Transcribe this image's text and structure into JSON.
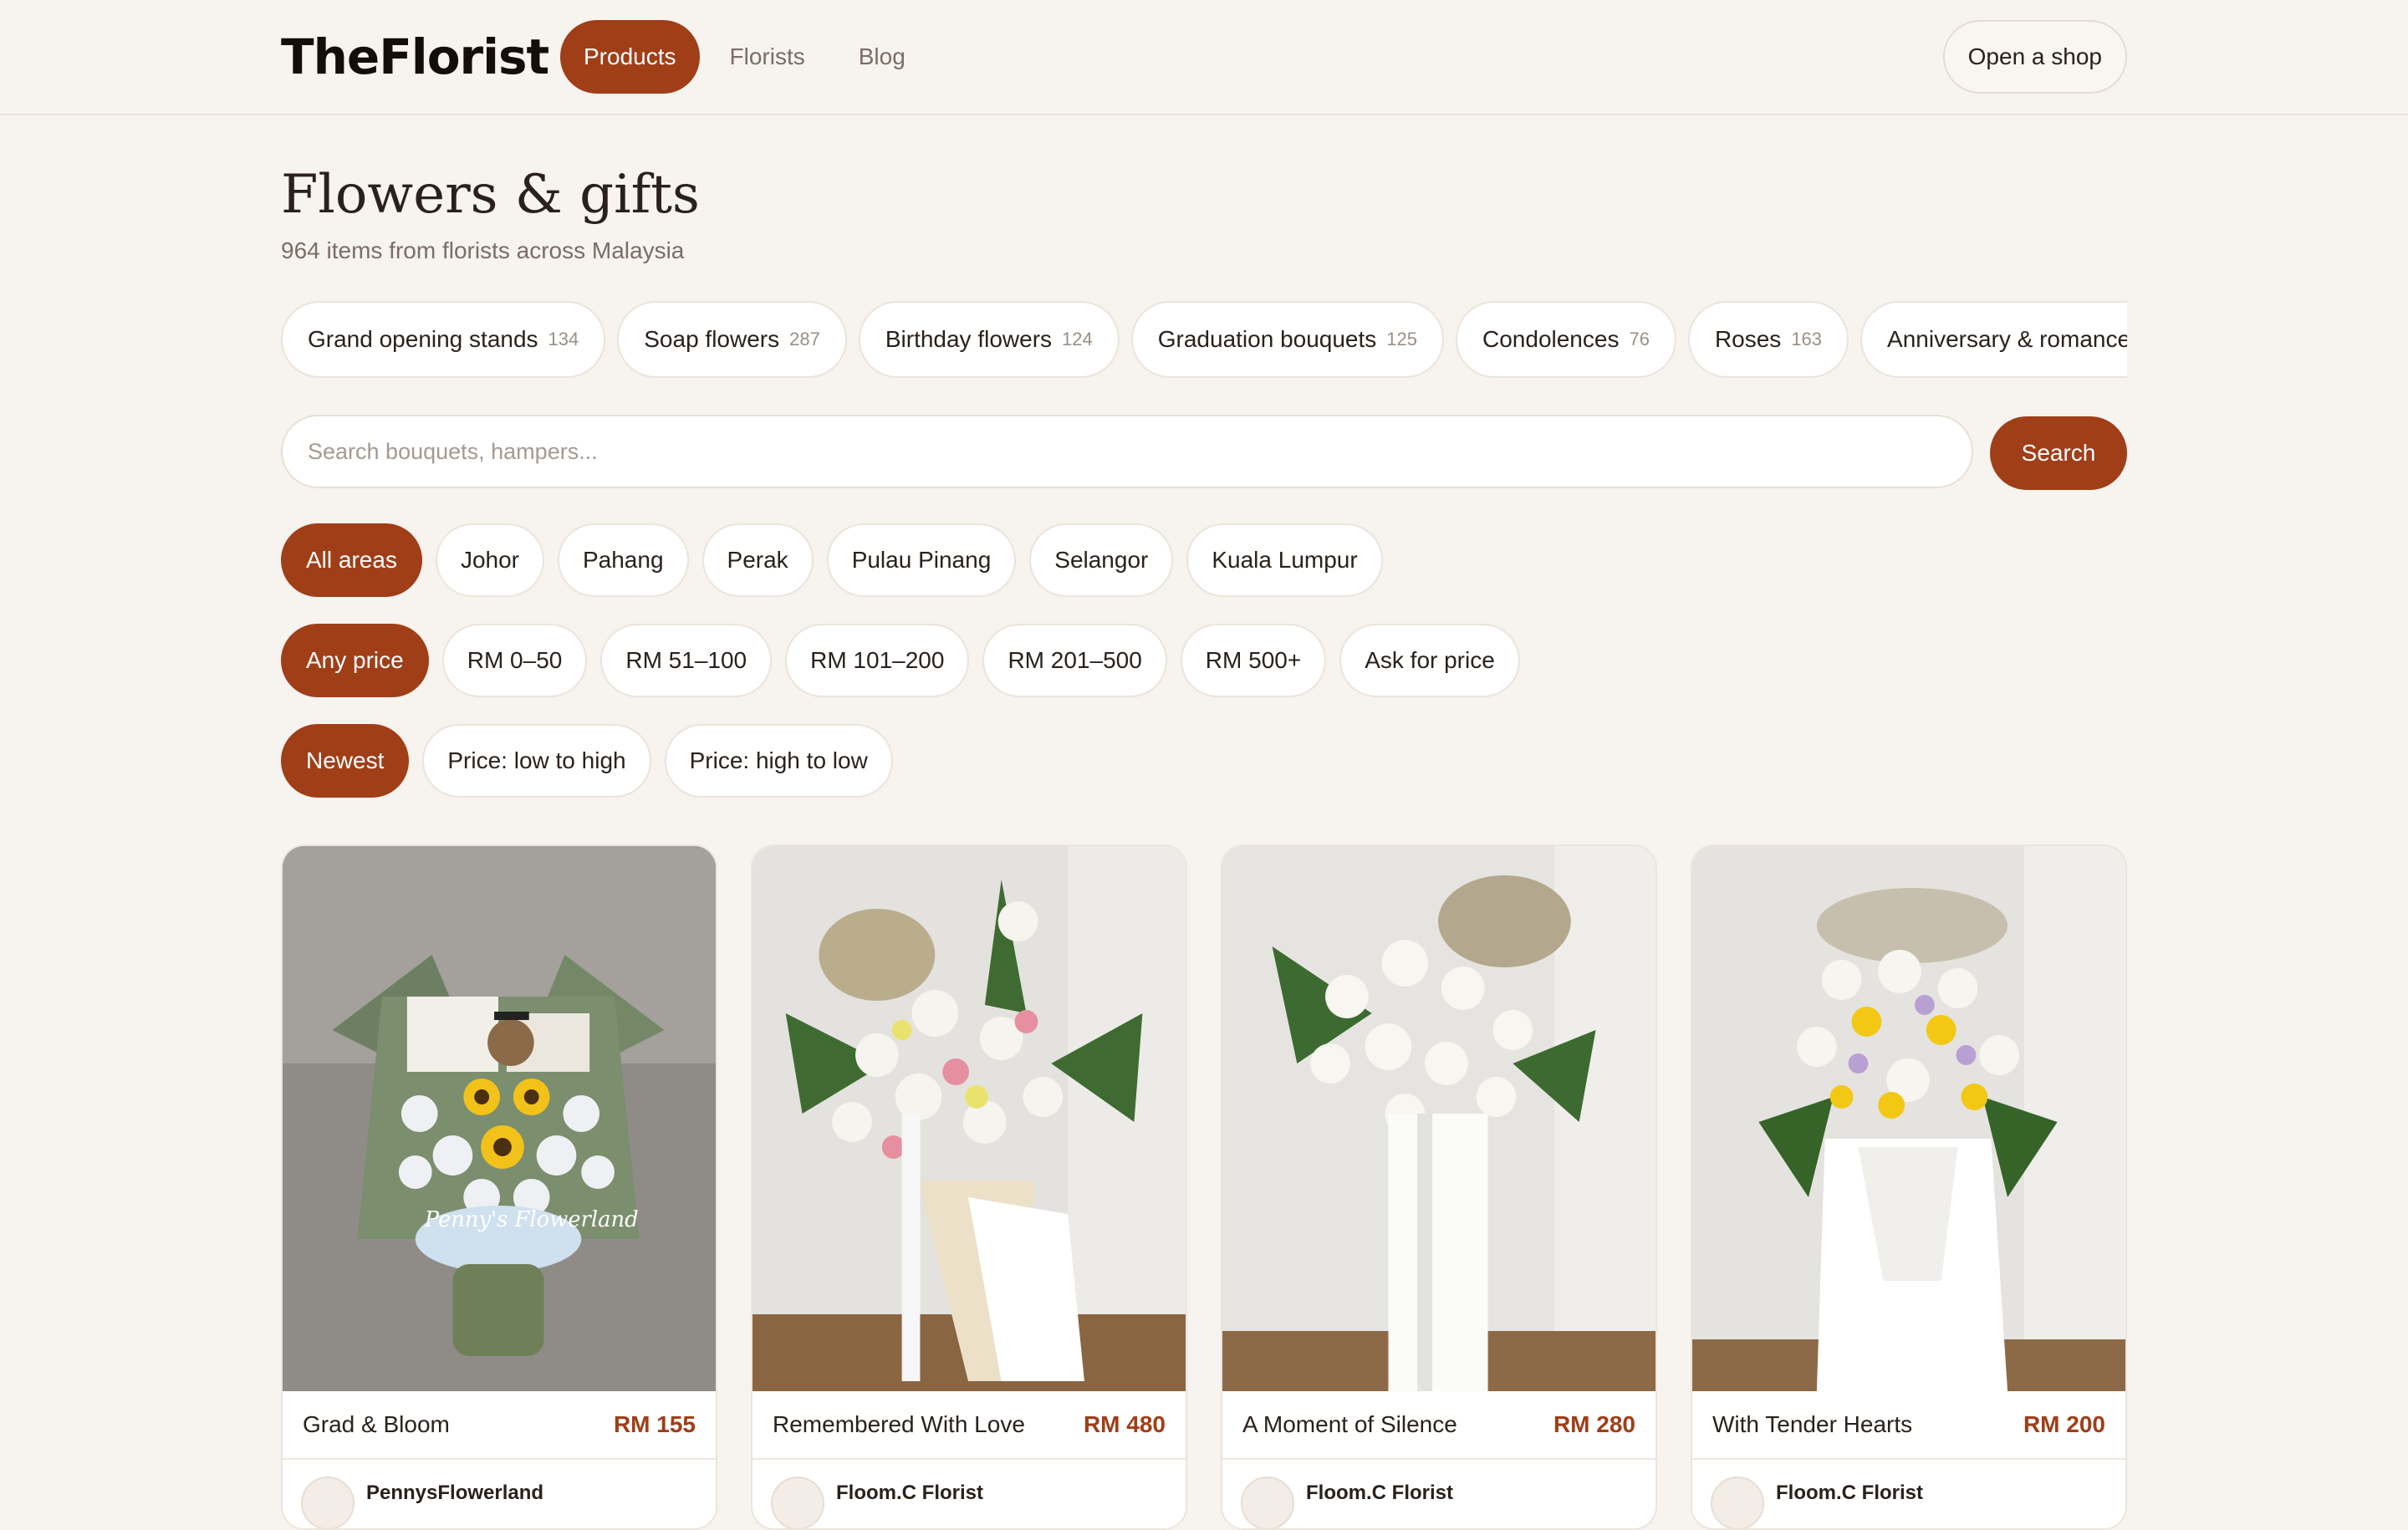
{
  "header": {
    "logo": "TheFlorist",
    "nav": [
      {
        "label": "Products",
        "active": true
      },
      {
        "label": "Florists",
        "active": false
      },
      {
        "label": "Blog",
        "active": false
      }
    ],
    "open_shop_label": "Open a shop"
  },
  "page": {
    "title": "Flowers & gifts",
    "subtitle": "964 items from florists across Malaysia"
  },
  "categories": [
    {
      "label": "Grand opening stands",
      "count": "134"
    },
    {
      "label": "Soap flowers",
      "count": "287"
    },
    {
      "label": "Birthday flowers",
      "count": "124"
    },
    {
      "label": "Graduation bouquets",
      "count": "125"
    },
    {
      "label": "Condolences",
      "count": "76"
    },
    {
      "label": "Roses",
      "count": "163"
    },
    {
      "label": "Anniversary & romance",
      "count": "88"
    }
  ],
  "search": {
    "placeholder": "Search bouquets, hampers...",
    "button_label": "Search"
  },
  "filters": {
    "areas": [
      "All areas",
      "Johor",
      "Pahang",
      "Perak",
      "Pulau Pinang",
      "Selangor",
      "Kuala Lumpur"
    ],
    "prices": [
      "Any price",
      "RM 0–50",
      "RM 51–100",
      "RM 101–200",
      "RM 201–500",
      "RM 500+",
      "Ask for price"
    ],
    "sort": [
      "Newest",
      "Price: low to high",
      "Price: high to low"
    ]
  },
  "products": [
    {
      "name": "Grad & Bloom",
      "price": "RM 155",
      "seller": "PennysFlowerland",
      "photo_watermark": "Penny's Flowerland"
    },
    {
      "name": "Remembered With Love",
      "price": "RM 480",
      "seller": "Floom.C Florist"
    },
    {
      "name": "A Moment of Silence",
      "price": "RM 280",
      "seller": "Floom.C Florist"
    },
    {
      "name": "With Tender Hearts",
      "price": "RM 200",
      "seller": "Floom.C Florist"
    }
  ],
  "colors": {
    "accent": "#a03e18",
    "background": "#f7f3ef"
  }
}
